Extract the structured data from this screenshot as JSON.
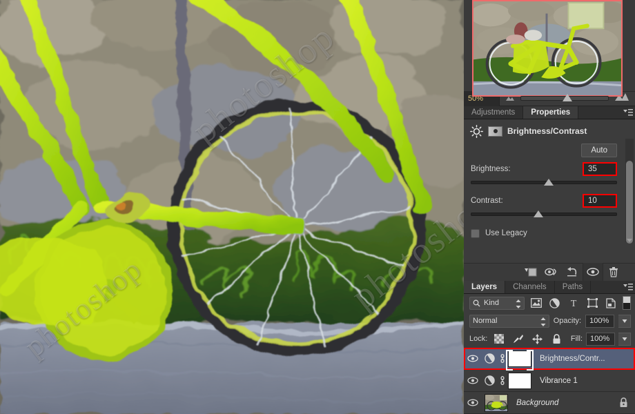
{
  "app": {
    "name": "Adobe Photoshop",
    "watermark_text": "photoshop"
  },
  "navigator": {
    "zoom_level": "50%",
    "view_box_color": "#f06a6a",
    "thumbnail_alt": "green bicycle leaning against stone wall"
  },
  "panel_tabs": {
    "items": [
      {
        "label": "Adjustments",
        "active": false
      },
      {
        "label": "Properties",
        "active": true
      }
    ],
    "menu_icon": "panel-menu-icon"
  },
  "properties": {
    "title": "Brightness/Contrast",
    "title_icon": "brightness-sun-icon",
    "preset_icon": "preset-gradient-icon",
    "auto_label": "Auto",
    "controls": [
      {
        "label": "Brightness:",
        "value": "35",
        "slider_pct": 57,
        "highlight_color": "#ff0000"
      },
      {
        "label": "Contrast:",
        "value": "10",
        "slider_pct": 49,
        "highlight_color": "#ff0000"
      }
    ],
    "use_legacy": {
      "label": "Use Legacy",
      "checked": false
    },
    "footer_icons": [
      "clip-to-layer-icon",
      "view-previous-state-icon",
      "reset-adjustment-icon",
      "toggle-layer-visibility-icon",
      "delete-adjustment-layer-icon"
    ]
  },
  "layers_panel": {
    "tabs": [
      {
        "label": "Layers",
        "active": true
      },
      {
        "label": "Channels",
        "active": false
      },
      {
        "label": "Paths",
        "active": false
      }
    ],
    "menu_icon": "panel-menu-icon",
    "filter": {
      "kind_label": "Kind",
      "search_icon": "search-icon",
      "type_filters": [
        "filter-pixel-layers-icon",
        "filter-adjustment-layers-icon",
        "filter-type-layers-icon",
        "filter-shape-layers-icon",
        "filter-smart-object-icon"
      ],
      "toggle_icon": "filter-enable-toggle"
    },
    "blend": {
      "mode": "Normal",
      "opacity_label": "Opacity:",
      "opacity_value": "100%"
    },
    "lock": {
      "label": "Lock:",
      "icons": [
        "lock-transparent-pixels-icon",
        "lock-image-pixels-icon",
        "lock-position-icon",
        "lock-all-icon"
      ],
      "fill_label": "Fill:",
      "fill_value": "100%"
    },
    "rows": [
      {
        "name": "Brightness/Contr...",
        "type": "adjustment",
        "visible": true,
        "selected": true,
        "highlighted": true,
        "linked": true,
        "mask_selected": true,
        "locked": false,
        "italic": false
      },
      {
        "name": "Vibrance 1",
        "type": "adjustment",
        "visible": true,
        "selected": false,
        "highlighted": false,
        "linked": true,
        "mask_selected": false,
        "locked": false,
        "italic": false
      },
      {
        "name": "Background",
        "type": "image",
        "visible": true,
        "selected": false,
        "highlighted": false,
        "linked": false,
        "mask_selected": false,
        "locked": true,
        "italic": true
      }
    ]
  },
  "theme": {
    "panel_bg": "#3c3c3c",
    "dock_bg": "#2f2f2f",
    "selected_row": "#55607a",
    "accent_red": "#ff0000",
    "zoom_text": "#e0c37a"
  }
}
